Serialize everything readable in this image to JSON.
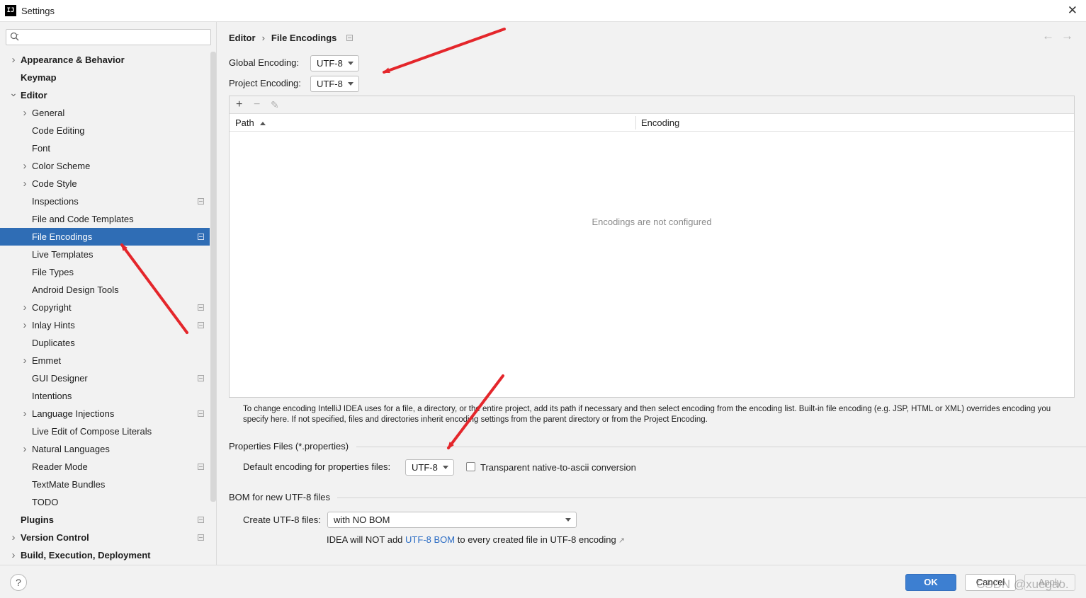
{
  "window": {
    "title": "Settings",
    "logo_text": "IJ"
  },
  "search": {
    "placeholder": "",
    "icon": "search-icon"
  },
  "sidebar": {
    "items": [
      {
        "label": "Appearance & Behavior",
        "level": 0,
        "chevron": "right",
        "bold": true,
        "config": false,
        "selected": false
      },
      {
        "label": "Keymap",
        "level": 0,
        "chevron": "none",
        "bold": true,
        "config": false,
        "selected": false
      },
      {
        "label": "Editor",
        "level": 0,
        "chevron": "down",
        "bold": true,
        "config": false,
        "selected": false
      },
      {
        "label": "General",
        "level": 1,
        "chevron": "right",
        "bold": false,
        "config": false,
        "selected": false
      },
      {
        "label": "Code Editing",
        "level": 1,
        "chevron": "none",
        "bold": false,
        "config": false,
        "selected": false
      },
      {
        "label": "Font",
        "level": 1,
        "chevron": "none",
        "bold": false,
        "config": false,
        "selected": false
      },
      {
        "label": "Color Scheme",
        "level": 1,
        "chevron": "right",
        "bold": false,
        "config": false,
        "selected": false
      },
      {
        "label": "Code Style",
        "level": 1,
        "chevron": "right",
        "bold": false,
        "config": false,
        "selected": false
      },
      {
        "label": "Inspections",
        "level": 1,
        "chevron": "none",
        "bold": false,
        "config": true,
        "selected": false
      },
      {
        "label": "File and Code Templates",
        "level": 1,
        "chevron": "none",
        "bold": false,
        "config": false,
        "selected": false
      },
      {
        "label": "File Encodings",
        "level": 1,
        "chevron": "none",
        "bold": false,
        "config": true,
        "selected": true
      },
      {
        "label": "Live Templates",
        "level": 1,
        "chevron": "none",
        "bold": false,
        "config": false,
        "selected": false
      },
      {
        "label": "File Types",
        "level": 1,
        "chevron": "none",
        "bold": false,
        "config": false,
        "selected": false
      },
      {
        "label": "Android Design Tools",
        "level": 1,
        "chevron": "none",
        "bold": false,
        "config": false,
        "selected": false
      },
      {
        "label": "Copyright",
        "level": 1,
        "chevron": "right",
        "bold": false,
        "config": true,
        "selected": false
      },
      {
        "label": "Inlay Hints",
        "level": 1,
        "chevron": "right",
        "bold": false,
        "config": true,
        "selected": false
      },
      {
        "label": "Duplicates",
        "level": 1,
        "chevron": "none",
        "bold": false,
        "config": false,
        "selected": false
      },
      {
        "label": "Emmet",
        "level": 1,
        "chevron": "right",
        "bold": false,
        "config": false,
        "selected": false
      },
      {
        "label": "GUI Designer",
        "level": 1,
        "chevron": "none",
        "bold": false,
        "config": true,
        "selected": false
      },
      {
        "label": "Intentions",
        "level": 1,
        "chevron": "none",
        "bold": false,
        "config": false,
        "selected": false
      },
      {
        "label": "Language Injections",
        "level": 1,
        "chevron": "right",
        "bold": false,
        "config": true,
        "selected": false
      },
      {
        "label": "Live Edit of Compose Literals",
        "level": 1,
        "chevron": "none",
        "bold": false,
        "config": false,
        "selected": false
      },
      {
        "label": "Natural Languages",
        "level": 1,
        "chevron": "right",
        "bold": false,
        "config": false,
        "selected": false
      },
      {
        "label": "Reader Mode",
        "level": 1,
        "chevron": "none",
        "bold": false,
        "config": true,
        "selected": false
      },
      {
        "label": "TextMate Bundles",
        "level": 1,
        "chevron": "none",
        "bold": false,
        "config": false,
        "selected": false
      },
      {
        "label": "TODO",
        "level": 1,
        "chevron": "none",
        "bold": false,
        "config": false,
        "selected": false
      },
      {
        "label": "Plugins",
        "level": 0,
        "chevron": "none",
        "bold": true,
        "config": true,
        "selected": false
      },
      {
        "label": "Version Control",
        "level": 0,
        "chevron": "right",
        "bold": true,
        "config": true,
        "selected": false
      },
      {
        "label": "Build, Execution, Deployment",
        "level": 0,
        "chevron": "right",
        "bold": true,
        "config": false,
        "selected": false
      }
    ]
  },
  "breadcrumb": {
    "parent": "Editor",
    "separator": "›",
    "current": "File Encodings"
  },
  "nav": {
    "back": "←",
    "forward": "→"
  },
  "encodings": {
    "global_label": "Global Encoding:",
    "global_value": "UTF-8",
    "project_label": "Project Encoding:",
    "project_value": "UTF-8"
  },
  "table": {
    "toolbar": {
      "add": "+",
      "remove": "−",
      "edit": "✎"
    },
    "columns": [
      "Path",
      "Encoding"
    ],
    "empty_text": "Encodings are not configured"
  },
  "hint_text": "To change encoding IntelliJ IDEA uses for a file, a directory, or the entire project, add its path if necessary and then select encoding from the encoding list. Built-in file encoding (e.g. JSP, HTML or XML) overrides encoding you specify here. If not specified, files and directories inherit encoding settings from the parent directory or from the Project Encoding.",
  "properties": {
    "group_title": "Properties Files (*.properties)",
    "default_label": "Default encoding for properties files:",
    "default_value": "UTF-8",
    "checkbox_label": "Transparent native-to-ascii conversion",
    "checkbox_checked": false
  },
  "bom": {
    "group_title": "BOM for new UTF-8 files",
    "create_label": "Create UTF-8 files:",
    "create_value": "with NO BOM",
    "info_prefix": "IDEA will NOT add",
    "info_link": "UTF-8 BOM",
    "info_suffix": "to every created file in UTF-8 encoding",
    "info_arrow": "↗"
  },
  "footer": {
    "help": "?",
    "ok": "OK",
    "cancel": "Cancel",
    "apply": "Apply",
    "watermark": "CSDN @xuegao."
  },
  "colors": {
    "accent": "#2f6db5",
    "ok_button": "#3d7fd1",
    "link": "#2b6cc4",
    "annotation_arrow": "#e4262b"
  }
}
